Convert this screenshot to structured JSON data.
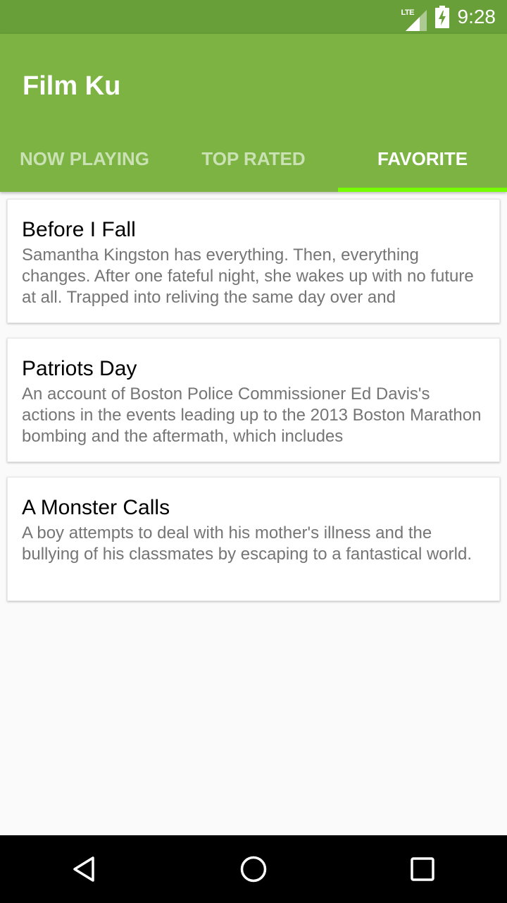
{
  "status_bar": {
    "network_label": "LTE",
    "time": "9:28"
  },
  "app": {
    "title": "Film Ku"
  },
  "tabs": [
    {
      "label": "NOW PLAYING",
      "active": false
    },
    {
      "label": "TOP RATED",
      "active": false
    },
    {
      "label": "FAVORITE",
      "active": true
    }
  ],
  "colors": {
    "status_bar": "#689f38",
    "app_bar": "#7cb342",
    "tab_indicator": "#76ff03"
  },
  "movies": [
    {
      "title": "Before I Fall",
      "description": "Samantha Kingston has everything. Then, everything changes. After one fateful night, she wakes up with no future at all. Trapped into reliving the same day over and"
    },
    {
      "title": "Patriots Day",
      "description": "An account of Boston Police Commissioner Ed Davis's actions in the events leading up to the 2013 Boston Marathon bombing and the aftermath, which includes"
    },
    {
      "title": "A Monster Calls",
      "description": "A boy attempts to deal with his mother's illness and the bullying of his classmates by escaping to a fantastical world."
    }
  ],
  "nav_bar": {
    "icons": [
      "back-icon",
      "home-icon",
      "recents-icon"
    ]
  }
}
